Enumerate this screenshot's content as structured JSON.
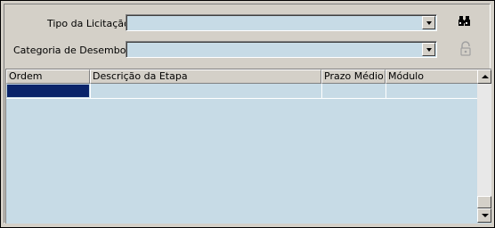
{
  "form": {
    "tipo_label": "Tipo da Licitação:",
    "tipo_value": "",
    "categoria_label": "Categoria de Desembolso:",
    "categoria_value": ""
  },
  "grid": {
    "columns": [
      "Ordem",
      "Descrição da Etapa",
      "Prazo Médio",
      "Módulo"
    ],
    "rows": [
      {
        "ordem": "",
        "descricao": "",
        "prazo": "",
        "modulo": ""
      }
    ]
  },
  "icons": {
    "search": "binoculars-icon",
    "lock": "padlock-icon"
  },
  "colors": {
    "field_bg": "#c7dbe6",
    "selection": "#0a246a",
    "panel": "#d4d0c8"
  }
}
